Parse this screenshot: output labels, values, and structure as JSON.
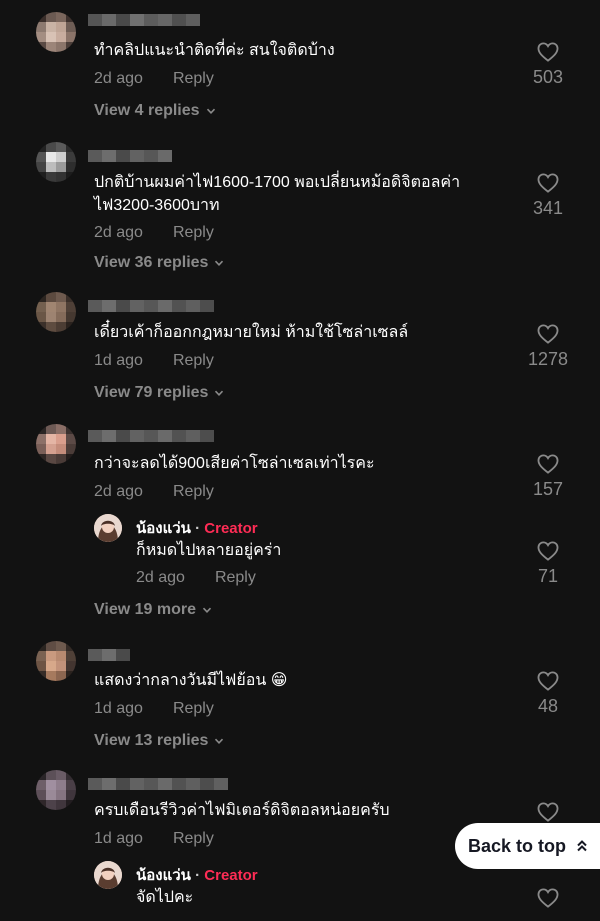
{
  "comments": [
    {
      "text": "ทำคลิปแนะนำติดที่ค่ะ สนใจติดบ้าง",
      "time": "2d ago",
      "reply": "Reply",
      "likes": "503",
      "view": "View 4 replies"
    },
    {
      "text": "ปกติบ้านผมค่าไฟ1600-1700 พอเปลี่ยนหม้อดิจิตอลค่าไฟ3200-3600บาท",
      "time": "2d ago",
      "reply": "Reply",
      "likes": "341",
      "view": "View 36 replies"
    },
    {
      "text": "เดี๋ยวเค้าก็ออกกฎหมายใหม่ ห้ามใช้โซล่าเซลล์",
      "time": "1d ago",
      "reply": "Reply",
      "likes": "1278",
      "view": "View 79 replies"
    },
    {
      "text": "กว่าจะลดได้900เสียค่าโซล่าเซลเท่าไรคะ",
      "time": "2d ago",
      "reply": "Reply",
      "likes": "157",
      "view": "View 19 more",
      "creator_reply": {
        "name": "น้องแว่น",
        "dot": "·",
        "badge": "Creator",
        "text": "ก็หมดไปหลายอยู่คร่า",
        "time": "2d ago",
        "reply": "Reply",
        "likes": "71"
      }
    },
    {
      "text": "แสดงว่ากลางวันมีไฟย้อน 😁",
      "time": "1d ago",
      "reply": "Reply",
      "likes": "48",
      "view": "View 13 replies"
    },
    {
      "text": "ครบเดือนรีวิวค่าไฟมิเตอร์ดิจิตอลหน่อยครับ",
      "time": "1d ago",
      "reply": "Reply",
      "creator_reply": {
        "name": "น้องแว่น",
        "dot": "·",
        "badge": "Creator",
        "text": "จัดไปคะ"
      }
    }
  ],
  "back_to_top": "Back to top",
  "colors": {
    "background": "#121212",
    "secondary_text": "#8a8a8a",
    "creator_accent": "#fe2c55"
  },
  "icons": {
    "like": "heart-outline-icon",
    "expand": "chevron-down-icon",
    "top": "double-chevron-up-icon"
  }
}
